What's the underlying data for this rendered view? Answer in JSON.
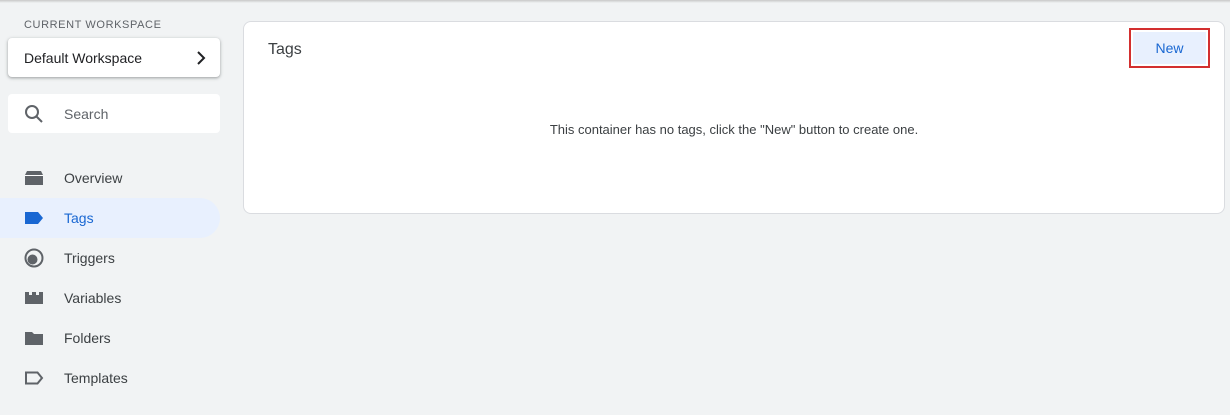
{
  "sidebar": {
    "workspace_label": "CURRENT WORKSPACE",
    "workspace_name": "Default Workspace",
    "search_placeholder": "Search",
    "items": [
      {
        "label": "Overview",
        "icon": "overview-icon"
      },
      {
        "label": "Tags",
        "icon": "tag-icon",
        "active": true
      },
      {
        "label": "Triggers",
        "icon": "trigger-icon"
      },
      {
        "label": "Variables",
        "icon": "variables-icon"
      },
      {
        "label": "Folders",
        "icon": "folder-icon"
      },
      {
        "label": "Templates",
        "icon": "template-icon"
      }
    ]
  },
  "main": {
    "title": "Tags",
    "new_button": "New",
    "empty_message": "This container has no tags, click the \"New\" button to create one."
  },
  "colors": {
    "accent": "#1967d2",
    "active_bg": "#e8f0fe",
    "highlight_border": "#d32f2f",
    "background": "#f1f3f4"
  }
}
